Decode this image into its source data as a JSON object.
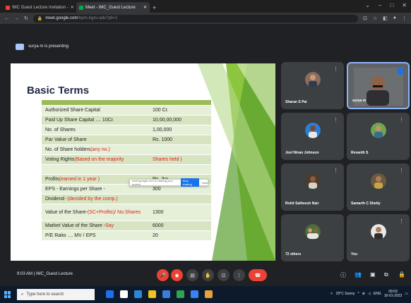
{
  "browser": {
    "tabs": [
      {
        "label": "IMC Guest Lecture Invitation - ",
        "active": false
      },
      {
        "label": "Meet - IMC_Guest Lecture",
        "active": true
      }
    ],
    "new_tab": "+",
    "url_host": "meet.google.com",
    "url_path": "/bpm-kgzu-adu?pli=1"
  },
  "meet": {
    "presenting_text": "surya m is presenting",
    "meeting_info": "9:03 AM  |  IMC_Guest Lecture"
  },
  "slide": {
    "title": "Basic Terms",
    "rows": [
      {
        "label": "Authorized Share Capital",
        "label_red": "",
        "value": "100 Cr.",
        "value_red": false
      },
      {
        "label": "Paid Up Share Capital  .... 10Cr.",
        "label_red": "",
        "value": "10,00,00,000",
        "value_red": false
      },
      {
        "label": "No. of Shares",
        "label_red": "",
        "value": "1,00,000",
        "value_red": false
      },
      {
        "label": "Par Value of Share",
        "label_red": "",
        "value": "Rs. 1000",
        "value_red": false
      },
      {
        "label": "No. of Share holders ",
        "label_red": "(any no.)",
        "value": "",
        "value_red": false
      },
      {
        "label": "Voting Rights ",
        "label_red": "(Based on the majority",
        "value": "Shares held )",
        "value_red": true
      },
      {
        "label": "",
        "label_red": "",
        "value": "",
        "value_red": false
      },
      {
        "label": "Profits ",
        "label_red": "(earned in 1 year )",
        "value": "Rs. 3cr.",
        "value_red": false
      },
      {
        "label": "EPS - Earnings per Share -",
        "label_red": "",
        "value": "300",
        "value_red": false
      },
      {
        "label": "Dividend  - ",
        "label_red": "(decided by the comp.)",
        "value": "",
        "value_red": false
      },
      {
        "label": "Value of the Share-",
        "label_red": "(SC+Profits)/ No.Shares",
        "value": "1300",
        "value_red": false,
        "tall": true
      },
      {
        "label": "Market Value of the Share - ",
        "label_red": "Say",
        "value": "6000",
        "value_red": false
      },
      {
        "label": "P/E Raito  .... MV / EPS",
        "label_red": "",
        "value": "20",
        "value_red": false
      }
    ],
    "popup_text": "meet.google.com is sharing your screen.",
    "popup_button": "Stop sharing",
    "popup_hide": "Hide"
  },
  "participants": [
    {
      "name": "Sharan S Pai"
    },
    {
      "name": "surya m"
    },
    {
      "name": "Joel Ninan Johnson"
    },
    {
      "name": "Revanth S"
    },
    {
      "name": "Rohit Satheesh Nair"
    },
    {
      "name": "Samarth C Shetty"
    },
    {
      "name": "72 others"
    },
    {
      "name": "You"
    }
  ],
  "taskbar": {
    "search_placeholder": "Type here to search",
    "weather": "29°C Sunny",
    "language": "ENG",
    "time": "09:03",
    "date": "16-01-2023"
  },
  "colors": {
    "slide_header_green": "#9bbb59",
    "leave_red": "#ea4335",
    "accent_blue": "#8ab4f8"
  }
}
